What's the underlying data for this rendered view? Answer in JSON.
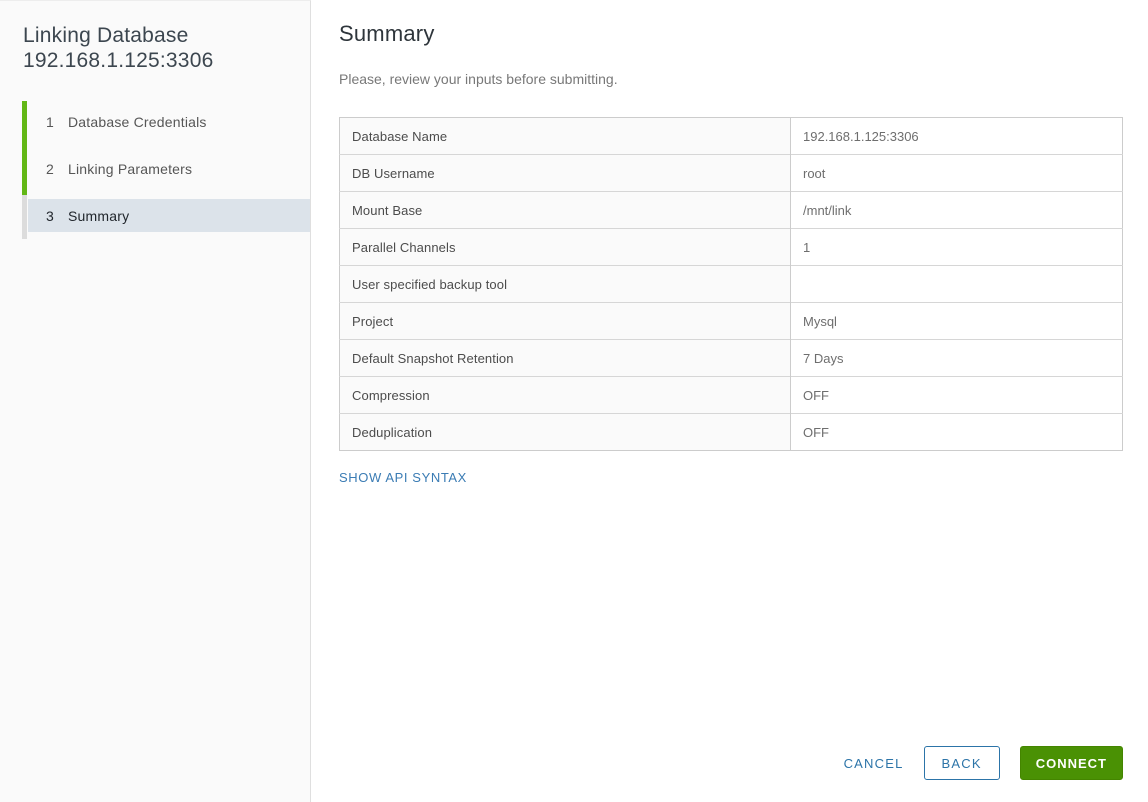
{
  "sidebar": {
    "title_line1": "Linking Database",
    "title_line2": "192.168.1.125:3306",
    "steps": [
      {
        "number": "1",
        "label": "Database Credentials",
        "state": "completed"
      },
      {
        "number": "2",
        "label": "Linking Parameters",
        "state": "completed"
      },
      {
        "number": "3",
        "label": "Summary",
        "state": "active"
      }
    ]
  },
  "main": {
    "heading": "Summary",
    "subtitle": "Please, review your inputs before submitting.",
    "summary_table": {
      "rows": [
        {
          "label": "Database Name",
          "value": "192.168.1.125:3306"
        },
        {
          "label": "DB Username",
          "value": "root"
        },
        {
          "label": "Mount Base",
          "value": "/mnt/link"
        },
        {
          "label": "Parallel Channels",
          "value": "1"
        },
        {
          "label": "User specified backup tool",
          "value": ""
        },
        {
          "label": "Project",
          "value": "Mysql"
        },
        {
          "label": "Default Snapshot Retention",
          "value": "7 Days"
        },
        {
          "label": "Compression",
          "value": "OFF"
        },
        {
          "label": "Deduplication",
          "value": "OFF"
        }
      ]
    },
    "api_syntax_link": "SHOW API SYNTAX"
  },
  "footer": {
    "cancel_label": "CANCEL",
    "back_label": "BACK",
    "connect_label": "CONNECT"
  },
  "colors": {
    "accent_blue": "#2c74a8",
    "link_blue": "#3b7cb4",
    "connect_green": "#4a9104",
    "progress_green": "#62b715",
    "active_step_bg": "#dce3ea"
  }
}
